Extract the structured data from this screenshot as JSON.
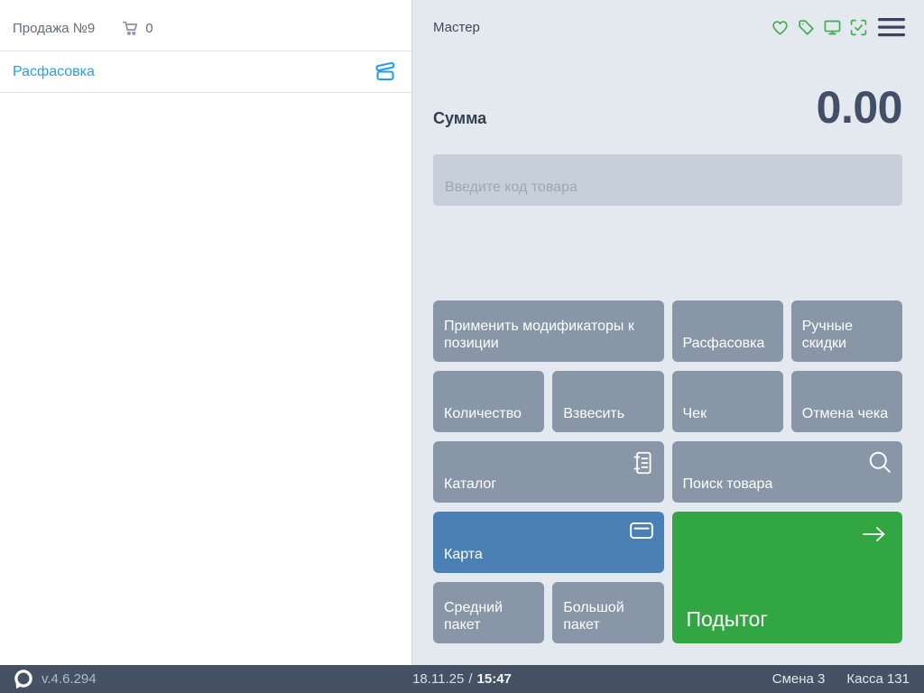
{
  "left_panel": {
    "sale_label": "Продажа №9",
    "cart_count": "0",
    "active_tab": "Расфасовка"
  },
  "right_panel": {
    "cashier_name": "Мастер",
    "sum_label": "Сумма",
    "sum_value": "0.00",
    "input_placeholder": "Введите код товара",
    "buttons": {
      "apply_modifiers": "Применить модификаторы к позиции",
      "packing": "Расфасовка",
      "manual_discounts": "Ручные скидки",
      "quantity": "Количество",
      "weigh": "Взвесить",
      "receipt": "Чек",
      "cancel_receipt": "Отмена чека",
      "catalog": "Каталог",
      "search_product": "Поиск товара",
      "card": "Карта",
      "subtotal": "Подытог",
      "medium_bag": "Средний пакет",
      "large_bag": "Большой пакет"
    }
  },
  "status_bar": {
    "version": "v.4.6.294",
    "date": "18.11.25",
    "separator": "/",
    "time": "15:47",
    "shift": "Смена 3",
    "register": "Касса 131"
  },
  "colors": {
    "accent_green_icons": "#3EAD4B",
    "button_gray": "#8896A8",
    "button_blue": "#4B80B4",
    "button_green": "#33A644",
    "tab_blue": "#27A0E0",
    "statusbar_bg": "#475164",
    "panel_bg": "#E4E9EF",
    "input_bg": "#C6CFDA",
    "sum_text": "#434F68"
  },
  "icons": [
    "cart-icon",
    "open-box-icon",
    "heart-icon",
    "tag-icon",
    "display-icon",
    "scan-check-icon",
    "menu-icon",
    "catalog-icon",
    "search-icon",
    "card-icon",
    "arrow-right-icon",
    "logo-mark"
  ]
}
